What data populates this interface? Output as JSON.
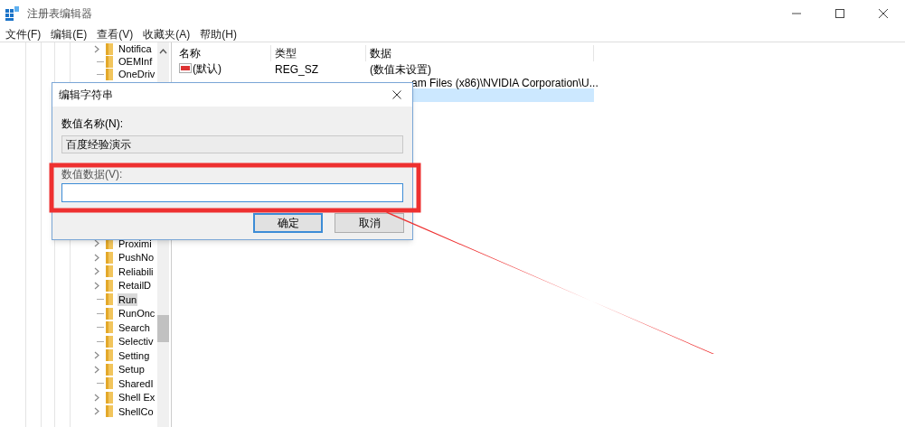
{
  "window": {
    "title": "注册表编辑器"
  },
  "menu": [
    "文件(F)",
    "编辑(E)",
    "查看(V)",
    "收藏夹(A)",
    "帮助(H)"
  ],
  "tree": {
    "items_top": [
      {
        "label": "Notifica",
        "expandable": true,
        "selected": false
      },
      {
        "label": "OEMInf",
        "expandable": false,
        "selected": false
      },
      {
        "label": "OneDriv",
        "expandable": false,
        "selected": false
      }
    ],
    "items_bottom": [
      {
        "label": "Proximi",
        "expandable": true,
        "selected": false
      },
      {
        "label": "PushNo",
        "expandable": true,
        "selected": false
      },
      {
        "label": "Reliabili",
        "expandable": true,
        "selected": false
      },
      {
        "label": "RetailD",
        "expandable": true,
        "selected": false
      },
      {
        "label": "Run",
        "expandable": false,
        "selected": true
      },
      {
        "label": "RunOnc",
        "expandable": false,
        "selected": false
      },
      {
        "label": "Search",
        "expandable": false,
        "selected": false
      },
      {
        "label": "Selectiv",
        "expandable": false,
        "selected": false
      },
      {
        "label": "Setting",
        "expandable": true,
        "selected": false
      },
      {
        "label": "Setup",
        "expandable": true,
        "selected": false
      },
      {
        "label": "SharedI",
        "expandable": false,
        "selected": false
      },
      {
        "label": "Shell Ex",
        "expandable": true,
        "selected": false
      },
      {
        "label": "ShellCo",
        "expandable": true,
        "selected": false
      }
    ]
  },
  "table": {
    "columns": [
      "名称",
      "类型",
      "数据"
    ],
    "rows": [
      {
        "name": "(默认)",
        "type": "REG_SZ",
        "data": "(数值未设置)",
        "selected": false
      },
      {
        "data": "am Files (x86)\\NVIDIA Corporation\\U...",
        "selected": false
      },
      {
        "selected": true
      }
    ]
  },
  "dialog": {
    "title": "编辑字符串",
    "name_label": "数值名称(N):",
    "name_value": "百度经验演示",
    "data_label": "数值数据(V):",
    "buttons": [
      {
        "label": "确定",
        "focused": true
      },
      {
        "label": "取消",
        "focused": false
      }
    ]
  }
}
